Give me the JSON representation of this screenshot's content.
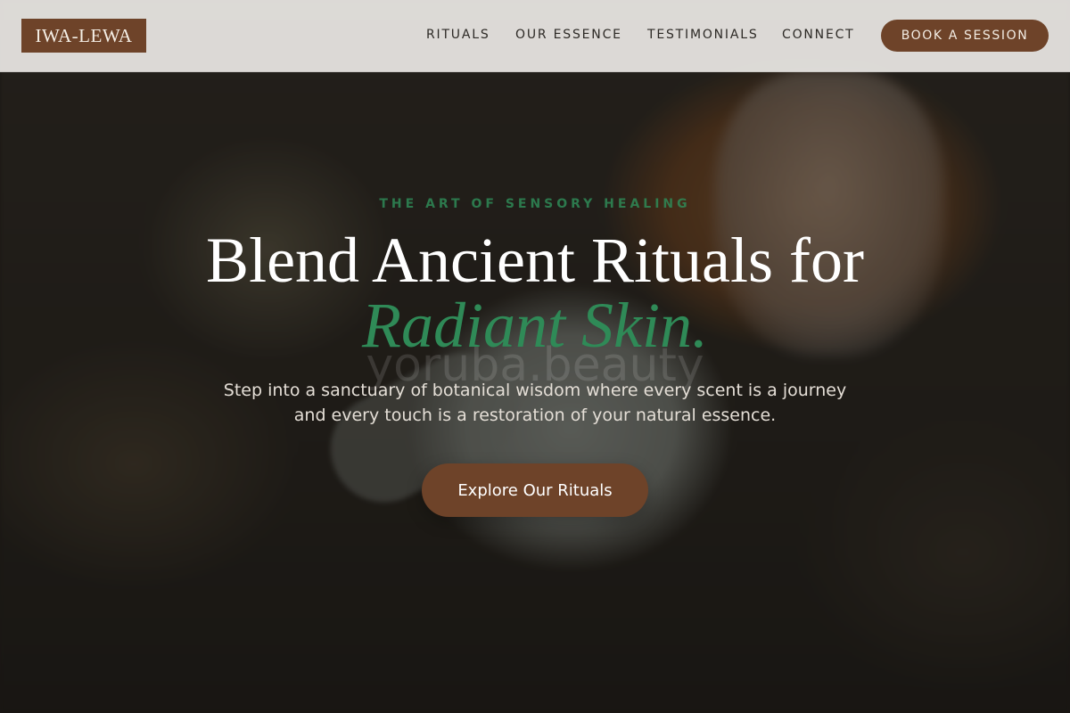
{
  "brand": {
    "logo_text": "IWA-LEWA"
  },
  "nav": {
    "items": [
      {
        "label": "RITUALS"
      },
      {
        "label": "OUR ESSENCE"
      },
      {
        "label": "TESTIMONIALS"
      },
      {
        "label": "CONNECT"
      }
    ],
    "cta_label": "BOOK A SESSION"
  },
  "hero": {
    "eyebrow": "THE ART OF SENSORY HEALING",
    "headline": "Blend Ancient Rituals for",
    "headline_accent": "Radiant Skin.",
    "watermark": "yoruba.beauty",
    "subtext": "Step into a sanctuary of botanical wisdom where every scent is a journey and every touch is a restoration of your natural essence.",
    "cta_label": "Explore Our Rituals"
  },
  "colors": {
    "brand_brown": "#6e4329",
    "accent_green": "#2f8a57",
    "header_bg": "#e8e6e2"
  }
}
